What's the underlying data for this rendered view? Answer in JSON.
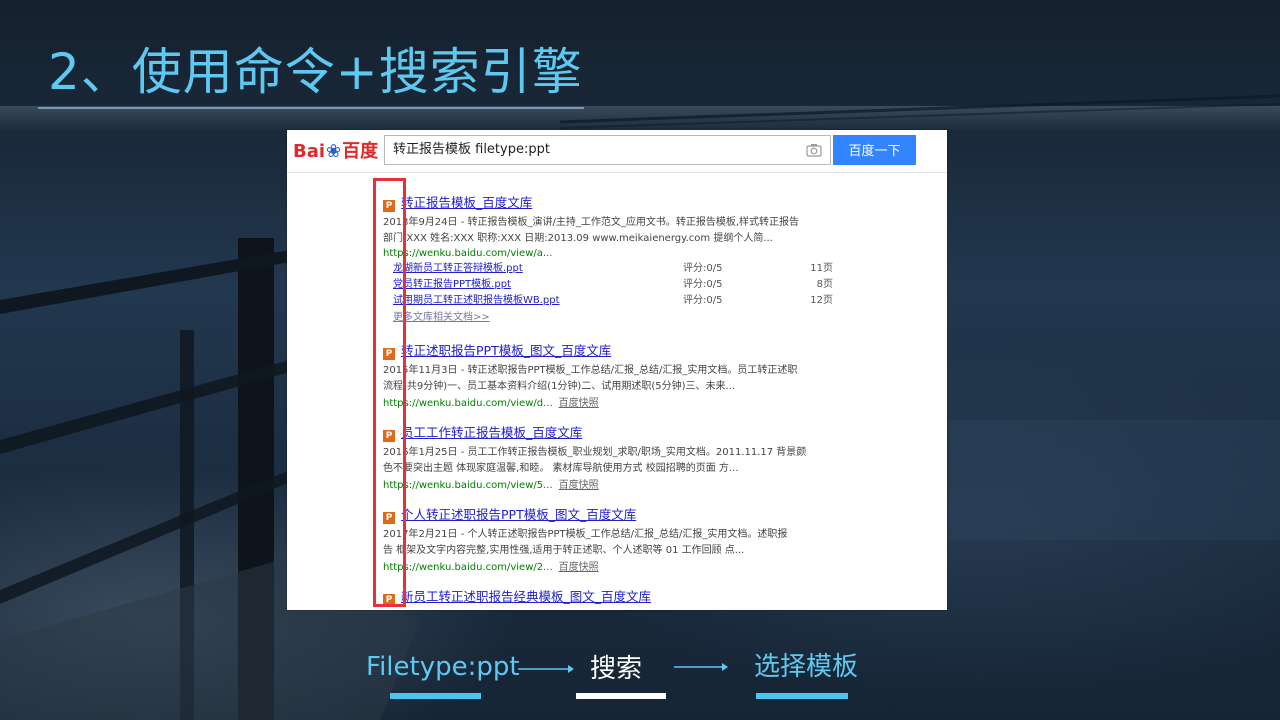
{
  "slide": {
    "title": "2、使用命令+搜索引擎"
  },
  "screenshot": {
    "logo": {
      "bai": "Bai",
      "du_cn": "百度"
    },
    "search": {
      "value": "转正报告模板 filetype:ppt",
      "button": "百度一下"
    },
    "results": [
      {
        "icon": "P",
        "title": "转正报告模板_百度文库",
        "desc": [
          "2013年9月24日 - 转正报告模板_演讲/主持_工作范文_应用文书。转正报告模板,样式转正报告",
          "部门:XXX 姓名:XXX 职称:XXX 日期:2013.09 www.meikaienergy.com 提纲个人简..."
        ],
        "url": "https://wenku.baidu.com/view/a...",
        "sub_links": [
          {
            "name": "龙湖新员工转正答辩模板.ppt",
            "score": "评分:0/5",
            "pages": "11页"
          },
          {
            "name": "党员转正报告PPT模板.ppt",
            "score": "评分:0/5",
            "pages": "8页"
          },
          {
            "name": "试用期员工转正述职报告模板WB.ppt",
            "score": "评分:0/5",
            "pages": "12页"
          }
        ],
        "more": "更多文库相关文档>>"
      },
      {
        "icon": "P",
        "title": "转正述职报告PPT模板_图文_百度文库",
        "desc": [
          "2015年11月3日 - 转正述职报告PPT模板_工作总结/汇报_总结/汇报_实用文档。员工转正述职",
          "流程(共9分钟)一、员工基本资料介绍(1分钟)二、试用期述职(5分钟)三、未来..."
        ],
        "url": "https://wenku.baidu.com/view/d...",
        "snapshot": "百度快照"
      },
      {
        "icon": "P",
        "title": "员工工作转正报告模板_百度文库",
        "desc": [
          "2016年1月25日 - 员工工作转正报告模板_职业规划_求职/职场_实用文档。2011.11.17 背景颜",
          "色不要突出主题 体现家庭温馨,和睦。 素材库导航使用方式 校园招聘的页面 方..."
        ],
        "url": "https://wenku.baidu.com/view/5...",
        "snapshot": "百度快照"
      },
      {
        "icon": "P",
        "title": "个人转正述职报告PPT模板_图文_百度文库",
        "desc": [
          "2017年2月21日 - 个人转正述职报告PPT模板_工作总结/汇报_总结/汇报_实用文档。述职报",
          "告 框架及文字内容完整,实用性强,适用于转正述职、个人述职等 01 工作回顾 点..."
        ],
        "url": "https://wenku.baidu.com/view/2...",
        "snapshot": "百度快照"
      },
      {
        "icon": "P",
        "title": "新员工转正述职报告经典模板_图文_百度文库"
      }
    ]
  },
  "flow": {
    "step1": "Filetype:ppt",
    "step2": "搜索",
    "step3": "选择模板"
  },
  "colors": {
    "accent": "#5ec9f0",
    "highlight": "#e8303a",
    "baidu_blue": "#3385ff",
    "baidu_red": "#de2a2a"
  }
}
